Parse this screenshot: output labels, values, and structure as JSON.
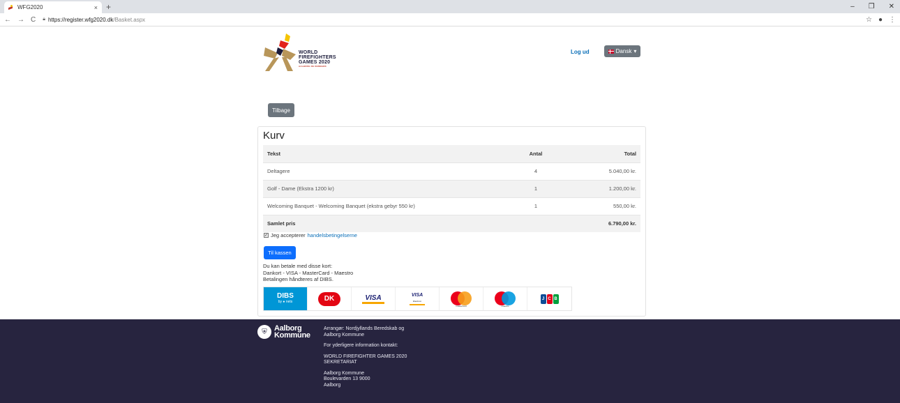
{
  "browser": {
    "tab_title": "WFG2020",
    "tab_close": "×",
    "new_tab": "+",
    "url_host": "https://register.wfg2020.dk",
    "url_path": "/Basket.aspx",
    "controls": [
      "–",
      "❐",
      "✕"
    ]
  },
  "header": {
    "logo_lines": [
      "WORLD",
      "FIREFIGHTERS",
      "GAMES 2020"
    ],
    "logo_sub": "AALBORG DE DENMARK",
    "logout": "Log ud",
    "language": "Dansk",
    "back": "Tilbage"
  },
  "basket": {
    "title": "Kurv",
    "columns": [
      "Tekst",
      "Antal",
      "Total"
    ],
    "rows": [
      {
        "text": "Deltagere",
        "qty": "4",
        "total": "5.040,00 kr."
      },
      {
        "text": "Golf - Dame (Ekstra 1200 kr)",
        "qty": "1",
        "total": "1.200,00 kr."
      },
      {
        "text": "Welcoming Banquet - Welcoming Banquet (ekstra gebyr 550 kr)",
        "qty": "1",
        "total": "550,00 kr."
      }
    ],
    "sum_label": "Samlet pris",
    "sum_value": "6.790,00 kr.",
    "accept_prefix": "Jeg accepterer",
    "accept_link": "handelsbetingelserne",
    "checkout": "Til kassen",
    "pay_line1": "Du kan betale med disse kort:",
    "pay_line2": "Dankort - VISA - MasterCard - Maestro",
    "pay_line3": "Betalingen håndteres af DIBS.",
    "card_logos": {
      "dibs": "DIBS",
      "dibs_sub": "by ● nets",
      "dankort": "DK",
      "visa": "VISA",
      "visa_electron": "VISA",
      "visa_electron_sub": "Electron",
      "mastercard": "mastercard",
      "maestro": "maestro",
      "jcb": [
        "J",
        "C",
        "B"
      ]
    }
  },
  "footer": {
    "org_line1": "Aalborg",
    "org_line2": "Kommune",
    "lines": [
      "Arrangør: Nordjyllands Beredskab og Aalborg Kommune",
      "For yderligere information kontakt:",
      "WORLD FIREFIGHTER GAMES 2020 SEKRETARIAT",
      "Aalborg Kommune Boulevarden 13 9000 Aalborg"
    ]
  }
}
